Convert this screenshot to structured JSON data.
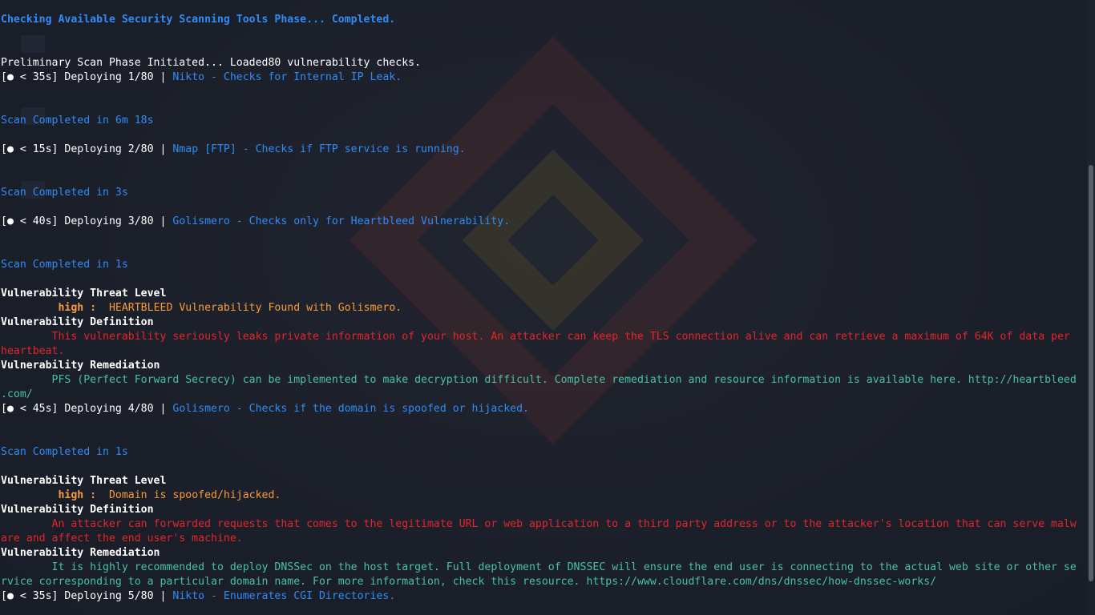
{
  "terminal": {
    "lines": {
      "l1": "Checking Available Security Scanning Tools Phase... Completed.",
      "l2": "Preliminary Scan Phase Initiated... Loaded80 vulnerability checks.",
      "l3a": "[● < 35s] Deploying 1/80 | ",
      "l3b": "Nikto - Checks for Internal IP Leak.",
      "l4": "Scan Completed in 6m 18s",
      "l5a": "[● < 15s] Deploying 2/80 | ",
      "l5b": "Nmap [FTP] - Checks if FTP service is running.",
      "l6": "Scan Completed in 3s",
      "l7a": "[● < 40s] Deploying 3/80 | ",
      "l7b": "Golismero - Checks only for Heartbleed Vulnerability.",
      "l8": "Scan Completed in 1s",
      "l9": "Vulnerability Threat Level",
      "l10a": "         high : ",
      "l10b": " HEARTBLEED Vulnerability Found with Golismero.",
      "l11": "Vulnerability Definition",
      "l12": "        This vulnerability seriously leaks private information of your host. An attacker can keep the TLS connection alive and can retrieve a maximum of 64K of data per",
      "l13": "heartbeat.",
      "l14": "Vulnerability Remediation",
      "l15": "        PFS (Perfect Forward Secrecy) can be implemented to make decryption difficult. Complete remediation and resource information is available here. http://heartbleed",
      "l16": ".com/",
      "l17a": "[● < 45s] Deploying 4/80 | ",
      "l17b": "Golismero - Checks if the domain is spoofed or hijacked.",
      "l18": "Scan Completed in 1s",
      "l19": "Vulnerability Threat Level",
      "l20a": "         high : ",
      "l20b": " Domain is spoofed/hijacked.",
      "l21": "Vulnerability Definition",
      "l22": "        An attacker can forwarded requests that comes to the legitimate URL or web application to a third party address or to the attacker's location that can serve malw",
      "l23": "are and affect the end user's machine.",
      "l24": "Vulnerability Remediation",
      "l25": "        It is highly recommended to deploy DNSSec on the host target. Full deployment of DNSSEC will ensure the end user is connecting to the actual web site or other se",
      "l26": "rvice corresponding to a particular domain name. For more information, check this resource. https://www.cloudflare.com/dns/dnssec/how-dnssec-works/",
      "l27a": "[● < 35s] Deploying 5/80 | ",
      "l27b": "Nikto - Enumerates CGI Directories."
    }
  },
  "colors": {
    "info_blue": "#2f8cf5",
    "severity_orange": "#f79b3a",
    "definition_red": "#e2262b",
    "remediation_teal": "#49c0a6",
    "background": "#1b1f2a"
  }
}
